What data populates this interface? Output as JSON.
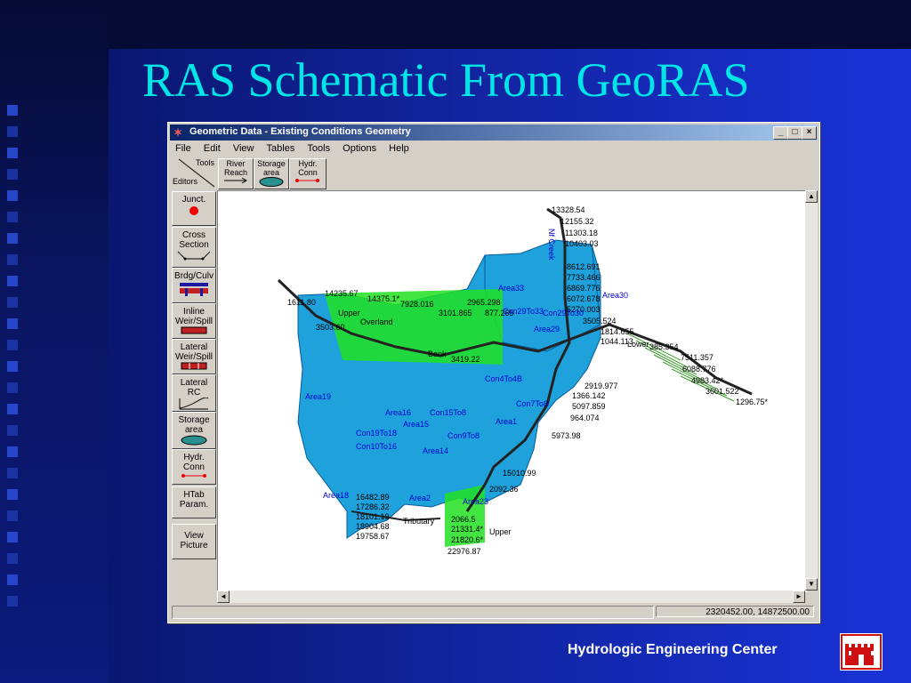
{
  "slide": {
    "title": "RAS Schematic From GeoRAS",
    "footer": "Hydrologic Engineering Center"
  },
  "window": {
    "title": "Geometric Data - Existing Conditions Geometry",
    "controls": [
      "_",
      "□",
      "×"
    ],
    "menu": [
      "File",
      "Edit",
      "View",
      "Tables",
      "Tools",
      "Options",
      "Help"
    ],
    "editors_label_tools": "Tools",
    "editors_label_editors": "Editors",
    "toolbar": [
      {
        "label1": "River",
        "label2": "Reach",
        "icon": "river-reach-icon"
      },
      {
        "label1": "Storage",
        "label2": "area",
        "icon": "storage-area-icon"
      },
      {
        "label1": "Hydr.",
        "label2": "Conn",
        "icon": "hydr-conn-icon"
      }
    ],
    "side_buttons": [
      {
        "label1": "Junct.",
        "label2": "",
        "icon": "junction-icon"
      },
      {
        "label1": "Cross",
        "label2": "Section",
        "icon": "cross-section-icon"
      },
      {
        "label1": "Brdg/Culv",
        "label2": "",
        "icon": "bridge-culvert-icon"
      },
      {
        "label1": "Inline",
        "label2": "Weir/Spill",
        "icon": "inline-weir-icon"
      },
      {
        "label1": "Lateral",
        "label2": "Weir/Spill",
        "icon": "lateral-weir-icon"
      },
      {
        "label1": "Lateral",
        "label2": "RC",
        "icon": "lateral-rc-icon"
      },
      {
        "label1": "Storage",
        "label2": "area",
        "icon": "storage-area-icon"
      },
      {
        "label1": "Hydr.",
        "label2": "Conn",
        "icon": "hydr-conn-icon"
      },
      {
        "label1": "HTab",
        "label2": "Param.",
        "icon": ""
      },
      {
        "label1": "View",
        "label2": "Picture",
        "icon": ""
      }
    ],
    "status_coords": "2320452.00, 14872500.00"
  },
  "map": {
    "colors": {
      "area": "#1fa2dc",
      "overland": "#22e022",
      "text": "#0000cc",
      "label": "#000000"
    },
    "station_labels": [
      "13328.54",
      "12155.32",
      "11303.18",
      "10403.03",
      "8612.691",
      "7733.466",
      "6869.776",
      "6072.678",
      "5270.003",
      "3505.524",
      "1814.655",
      "1044.113",
      "385.354",
      "7511.357",
      "6088.776",
      "4983.42*",
      "3601.522",
      "1296.75*",
      "14235.67",
      "14375.1*",
      "7928.016",
      "2965.298",
      "3101.865",
      "877.265",
      "2919.977",
      "1366.142",
      "5097.859",
      "964.074",
      "1611.80",
      "3503.60",
      "16482.89",
      "17286.32",
      "18101.19",
      "18904.68",
      "19758.67",
      "2066.5",
      "21331.4*",
      "21820.6*",
      "22976.87",
      "5973.98",
      "15010.99",
      "2092.36",
      "3419.22"
    ],
    "area_labels": [
      "Area33",
      "Area30",
      "Area29",
      "Area19",
      "Area16",
      "Area15",
      "Area18",
      "Area2",
      "Area23",
      "Area1",
      "Area14"
    ],
    "connection_labels": [
      "Con29To33",
      "Con29To30",
      "Con15To8",
      "Con9To8",
      "Con19To18",
      "Con10To16",
      "Con4To4B",
      "Con7To8"
    ],
    "text_labels": [
      "Upper",
      "Overland",
      "Tributary",
      "Upper",
      "Lower",
      "Bank",
      "Nf Creek"
    ]
  }
}
